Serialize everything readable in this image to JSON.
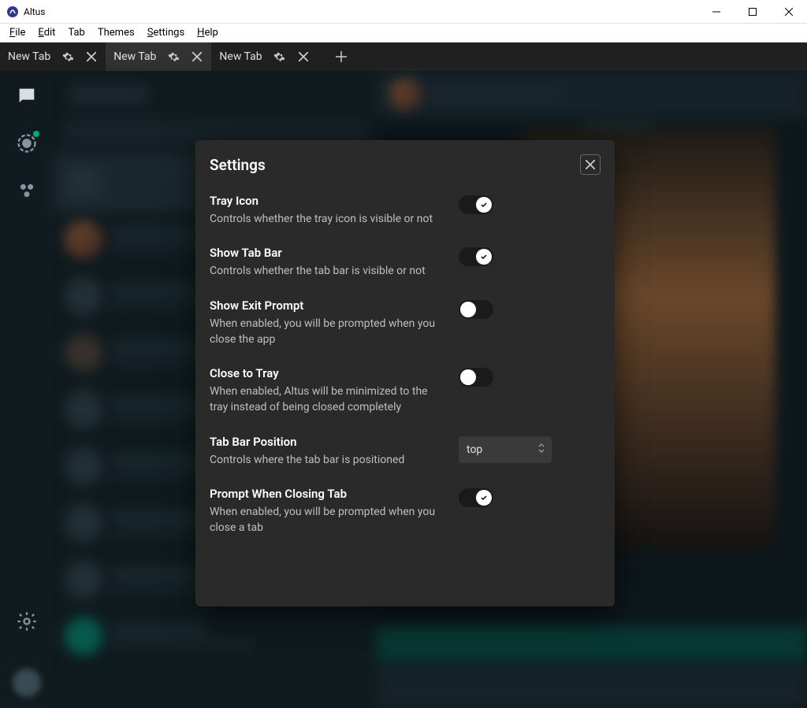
{
  "window": {
    "title": "Altus"
  },
  "menu": {
    "file": "File",
    "edit": "Edit",
    "tab": "Tab",
    "themes": "Themes",
    "settings": "Settings",
    "help": "Help"
  },
  "tabs": [
    {
      "label": "New Tab",
      "active": false
    },
    {
      "label": "New Tab",
      "active": true
    },
    {
      "label": "New Tab",
      "active": false
    }
  ],
  "modal": {
    "title": "Settings",
    "settings": {
      "trayIcon": {
        "title": "Tray Icon",
        "desc": "Controls whether the tray icon is visible or not",
        "value": true
      },
      "showTabBar": {
        "title": "Show Tab Bar",
        "desc": "Controls whether the tab bar is visible or not",
        "value": true
      },
      "showExitPrompt": {
        "title": "Show Exit Prompt",
        "desc": "When enabled, you will be prompted when you close the app",
        "value": false
      },
      "closeToTray": {
        "title": "Close to Tray",
        "desc": "When enabled, Altus will be minimized to the tray instead of being closed completely",
        "value": false
      },
      "tabBarPosition": {
        "title": "Tab Bar Position",
        "desc": "Controls where the tab bar is positioned",
        "value": "top"
      },
      "promptCloseTab": {
        "title": "Prompt When Closing Tab",
        "desc": "When enabled, you will be prompted when you close a tab",
        "value": true
      }
    }
  }
}
